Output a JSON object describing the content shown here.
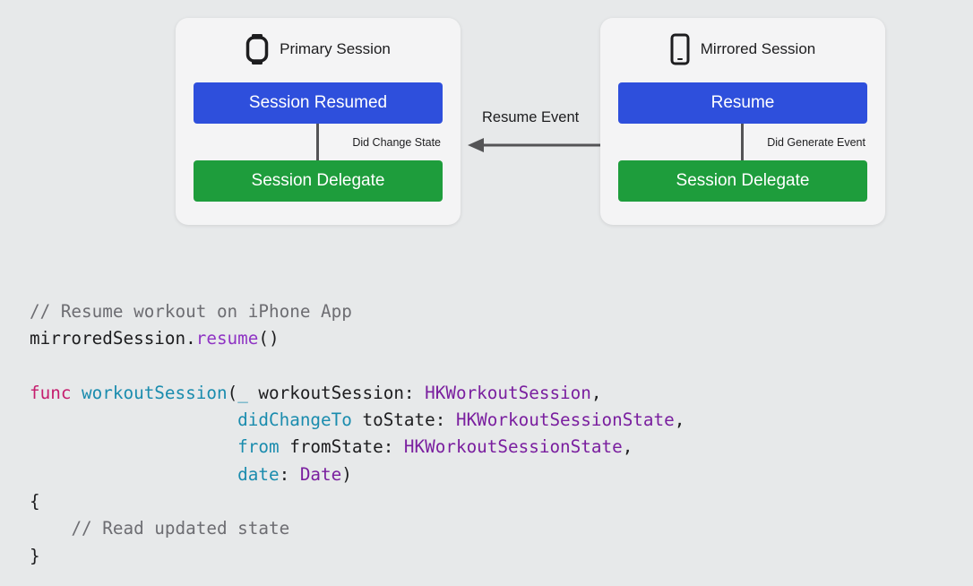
{
  "diagram": {
    "primary": {
      "title": "Primary Session",
      "icon": "watch-icon",
      "top_block": "Session Resumed",
      "bottom_block": "Session Delegate",
      "connector_label": "Did Change State"
    },
    "mirrored": {
      "title": "Mirrored Session",
      "icon": "iphone-icon",
      "top_block": "Resume",
      "bottom_block": "Session Delegate",
      "connector_label": "Did Generate Event"
    },
    "event_label": "Resume Event",
    "colors": {
      "blue_block": "#2e4fdc",
      "green_block": "#1e9d3c",
      "card": "#f4f4f5",
      "background": "#e7e9ea"
    }
  },
  "code": {
    "lines": [
      [
        {
          "text": "// Resume workout on iPhone App",
          "kind": "comment"
        }
      ],
      [
        {
          "text": "mirroredSession.",
          "kind": "plain"
        },
        {
          "text": "resume",
          "kind": "method"
        },
        {
          "text": "()",
          "kind": "plain"
        }
      ],
      [],
      [
        {
          "text": "func",
          "kind": "keyword"
        },
        {
          "text": " ",
          "kind": "plain"
        },
        {
          "text": "workoutSession",
          "kind": "func"
        },
        {
          "text": "(",
          "kind": "plain"
        },
        {
          "text": "_",
          "kind": "func"
        },
        {
          "text": " workoutSession: ",
          "kind": "plain"
        },
        {
          "text": "HKWorkoutSession",
          "kind": "type"
        },
        {
          "text": ",",
          "kind": "plain"
        }
      ],
      [
        {
          "text": "                    ",
          "kind": "plain"
        },
        {
          "text": "didChangeTo",
          "kind": "func"
        },
        {
          "text": " toState: ",
          "kind": "plain"
        },
        {
          "text": "HKWorkoutSessionState",
          "kind": "type"
        },
        {
          "text": ",",
          "kind": "plain"
        }
      ],
      [
        {
          "text": "                    ",
          "kind": "plain"
        },
        {
          "text": "from",
          "kind": "func"
        },
        {
          "text": " fromState: ",
          "kind": "plain"
        },
        {
          "text": "HKWorkoutSessionState",
          "kind": "type"
        },
        {
          "text": ",",
          "kind": "plain"
        }
      ],
      [
        {
          "text": "                    ",
          "kind": "plain"
        },
        {
          "text": "date",
          "kind": "func"
        },
        {
          "text": ": ",
          "kind": "plain"
        },
        {
          "text": "Date",
          "kind": "type"
        },
        {
          "text": ")",
          "kind": "plain"
        }
      ],
      [
        {
          "text": "{",
          "kind": "plain"
        }
      ],
      [
        {
          "text": "    ",
          "kind": "plain"
        },
        {
          "text": "// Read updated state",
          "kind": "comment"
        }
      ],
      [
        {
          "text": "}",
          "kind": "plain"
        }
      ]
    ],
    "colors": {
      "comment": "#6d6d72",
      "keyword": "#c51e6e",
      "func": "#1a8cae",
      "method": "#8f34c4",
      "type": "#7a1f9f",
      "plain": "#1d1d1f"
    }
  }
}
